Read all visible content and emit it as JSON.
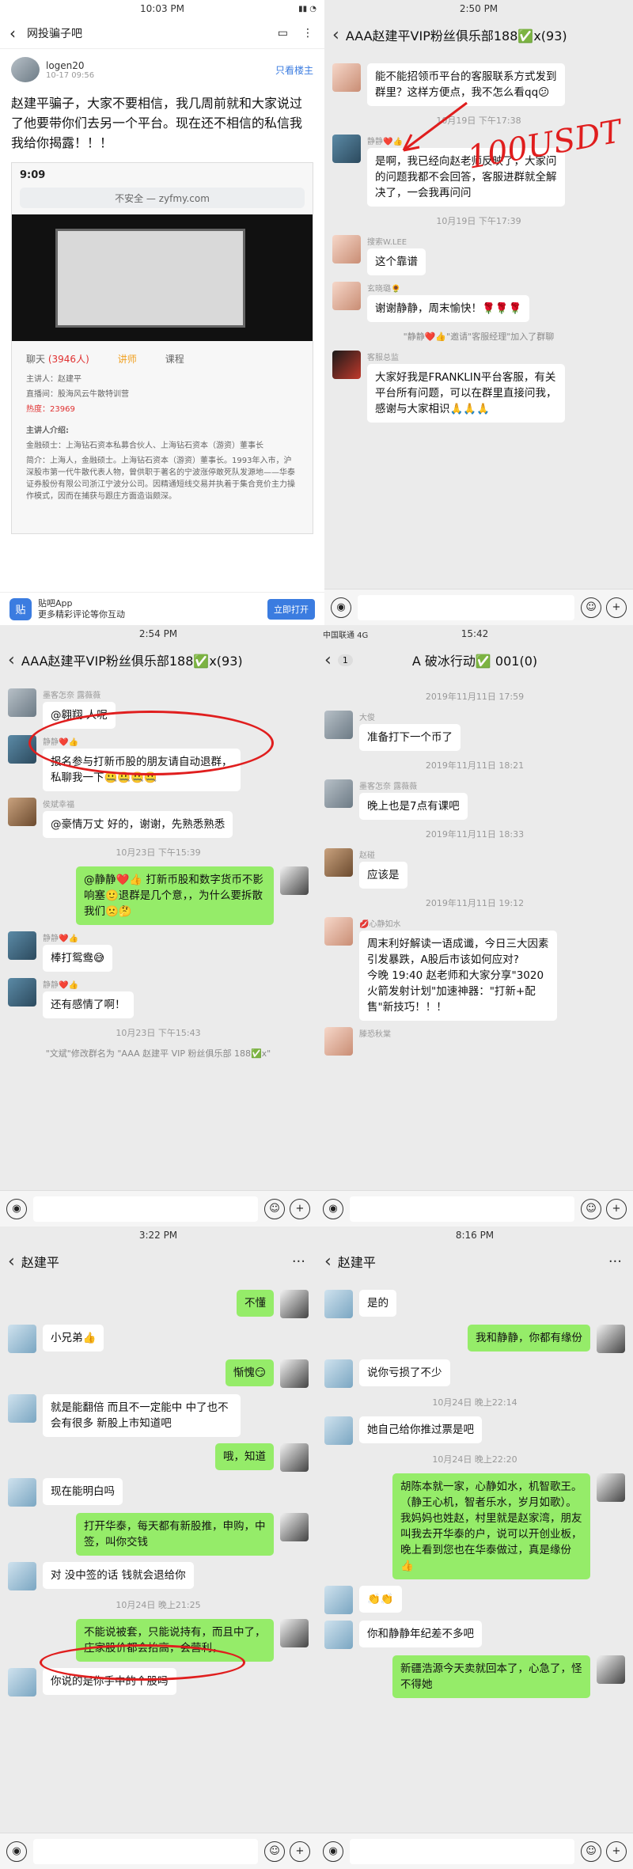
{
  "p1": {
    "status_time": "10:03 PM",
    "title": "网投骗子吧",
    "user": "logen20",
    "date": "10-17 09:56",
    "only_op": "只看楼主",
    "post": "赵建平骗子，大家不要相信，我几周前就和大家说过了他要带你们去另一个平台。现在还不相信的私信我我给你揭露！！！",
    "shot_time": "9:09",
    "shot_url": "不安全 — zyfmy.com",
    "tab_chat": "聊天",
    "tab_chat_count": "(3946人)",
    "tab_teacher": "讲师",
    "tab_course": "课程",
    "lecturer_name": "主讲人：赵建平",
    "lecturer_room": "直播间：股海风云牛散特训营",
    "lecturer_count": "热度：23969",
    "intro_title": "主讲人介绍:",
    "intro_1": "金融硕士：上海钻石资本私募合伙人、上海钻石资本（游资）董事长",
    "intro_2": "简介：上海人，金融硕士。上海钻石资本（游资）董事长。1993年入市，沪深股市第一代牛散代表人物，曾供职于著名的宁波涨停敢死队发源地——华泰证券股份有限公司浙江宁波分公司。因精通短线交易并执着于集合竞价主力操作模式，因而在捕获与跟庄方面造诣颇深。",
    "app_name": "贴吧App",
    "app_sub": "更多精彩评论等你互动",
    "app_open": "立即打开"
  },
  "p2": {
    "status_time": "2:50 PM",
    "title": "AAA赵建平VIP粉丝俱乐部188✅x(93)",
    "m1": "能不能招领币平台的客服联系方式发到群里？这样方便点，我不怎么看qq😕",
    "ts1": "10月19日 下午17:38",
    "n2": "静静❤️👍",
    "m2": "是啊，我已经向赵老师反映了，大家问的问题我都不会回答，客服进群就全解决了，一会我再问问",
    "ts2": "10月19日 下午17:39",
    "n3": "搜索W.LEE",
    "m3": "这个靠谱",
    "n4": "玄晓璐🌻",
    "m4": "谢谢静静，周末愉快！🌹🌹🌹",
    "sys": "\"静静❤️👍\"邀请\"客服经理\"加入了群聊",
    "n5": "客服总监",
    "m5": "大家好我是FRANKLIN平台客服，有关平台所有问题，可以在群里直接问我，感谢与大家相识🙏🙏🙏",
    "annotation": "100USDT"
  },
  "p3": {
    "status_time": "2:54 PM",
    "title": "AAA赵建平VIP粉丝俱乐部188✅x(93)",
    "n1": "墨客怎奈 露薇薇",
    "m1": "@翱翔  人呢",
    "n2": "静静❤️👍",
    "m2": "报名参与打新币股的朋友请自动退群，私聊我一下🤐🤐🤐🤐",
    "n3": "侯斌幸福",
    "m3": "@豪情万丈  好的，谢谢，先熟悉熟悉",
    "ts1": "10月23日 下午15:39",
    "m4": "@静静❤️👍 打新币股和数字货币不影响塞🙂退群是几个意，，为什么要拆散我们🙁🤔",
    "n5": "静静❤️👍",
    "m5": "棒打鸳鸯😅",
    "n6": "静静❤️👍",
    "m6": "还有感情了啊！",
    "ts2": "10月23日 下午15:43",
    "sys": "\"文斌\"修改群名为 \"AAA 赵建平 VIP 粉丝俱乐部 188✅x\""
  },
  "p4": {
    "status_left": "中国联通 4G",
    "status_time": "15:42",
    "back_count": "1",
    "title": "A 破冰行动✅ 001(0)",
    "ts1": "2019年11月11日 17:59",
    "n1": "大俊",
    "m1": "准备打下一个币了",
    "ts2": "2019年11月11日 18:21",
    "n2": "墨客怎奈 露薇薇",
    "m2": "晚上也是7点有课吧",
    "ts3": "2019年11月11日 18:33",
    "n3": "赵碰",
    "m3": "应该是",
    "ts4": "2019年11月11日 19:12",
    "n4": "💋心静如水",
    "m4": "周末利好解读一语成谶，今日三大因素引发暴跌，A股后市该如何应对?\n今晚 19:40 赵老师和大家分享\"3020火箭发射计划\"加速神器：\"打新+配售\"新技巧！！！",
    "n5": "滕恐秋棠"
  },
  "p5": {
    "status_time": "3:22 PM",
    "title": "赵建平",
    "m1": "不懂",
    "m2": "小兄弟👍",
    "m3": "惭愧😏",
    "m4": "就是能翻倍 而且不一定能中 中了也不会有很多 新股上市知道吧",
    "m5": "哦，知道",
    "m6": "现在能明白吗",
    "m7": "打开华泰，每天都有新股推，申购，中签，叫你交钱",
    "m8": "对 没中签的话 钱就会退给你",
    "ts1": "10月24日 晚上21:25",
    "m9": "不能说被套，只能说持有，而且中了，庄家股价都会抬高，会营利，",
    "m10": "你说的是你手中的个股吗"
  },
  "p6": {
    "status_time": "8:16 PM",
    "title": "赵建平",
    "m1": "是的",
    "m2": "我和静静，你都有缘份",
    "m3": "说你亏损了不少",
    "ts1": "10月24日 晚上22:14",
    "m4": "她自己给你推过票是吧",
    "ts2": "10月24日 晚上22:20",
    "m5": "胡陈本就一家，心静如水，机智歌王。（静王心机，智者乐水，岁月如歌）。我妈妈也姓赵，村里就是赵家湾，朋友叫我去开华泰的户，说可以开创业板，晚上看到您也在华泰做过，真是缘份👍",
    "m6": "👏👏",
    "m7": "你和静静年纪差不多吧",
    "m8": "新疆浩源今天卖就回本了，心急了，怪不得她"
  }
}
